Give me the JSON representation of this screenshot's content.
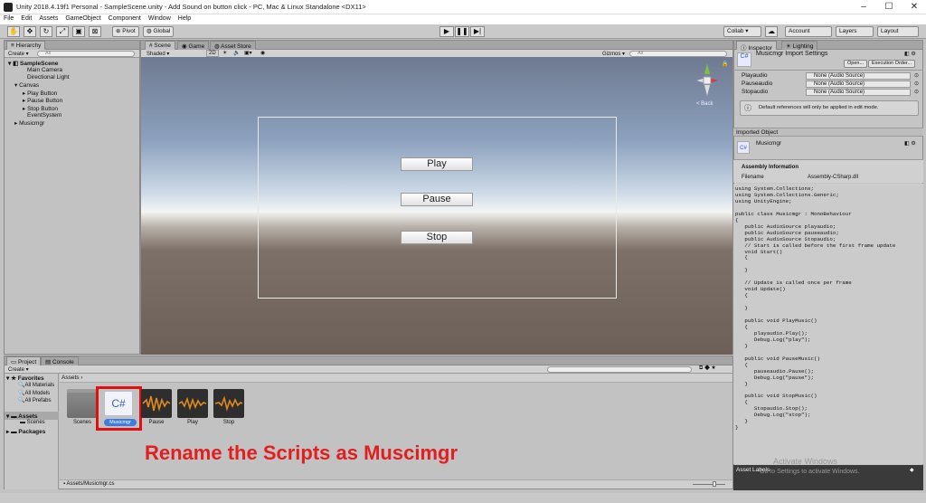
{
  "window": {
    "title": "Unity 2018.4.19f1 Personal - SampleScene.unity - Add Sound on button click - PC, Mac & Linux Standalone <DX11>"
  },
  "menu": [
    "File",
    "Edit",
    "Assets",
    "GameObject",
    "Component",
    "Window",
    "Help"
  ],
  "toolbar": {
    "pivot": "Pivot",
    "global": "Global",
    "collab": "Collab ▾",
    "account": "Account",
    "layers": "Layers",
    "layout": "Layout"
  },
  "hierarchy": {
    "tab": "Hierarchy",
    "create": "Create",
    "search": "All",
    "scene": "SampleScene",
    "items": [
      "Main Camera",
      "Directional Light",
      "Canvas",
      "Play Button",
      "Pause Button",
      "Stop Button",
      "EventSystem",
      "Musicmgr"
    ]
  },
  "scene_view": {
    "tabs": [
      "Scene",
      "Game",
      "Asset Store"
    ],
    "shading": "Shaded",
    "mode2d": "2D",
    "gizmos": "Gizmos",
    "search": "All",
    "back": "< Back",
    "buttons": {
      "play": "Play",
      "pause": "Pause",
      "stop": "Stop"
    }
  },
  "inspector": {
    "tabs": [
      "Inspector",
      "Lighting"
    ],
    "title": "Musicmgr Import Settings",
    "open": "Open...",
    "exec_order": "Execution Order...",
    "fields": [
      {
        "label": "Playaudio",
        "value": "None (Audio Source)"
      },
      {
        "label": "Pauseaudio",
        "value": "None (Audio Source)"
      },
      {
        "label": "Stopaudio",
        "value": "None (Audio Source)"
      }
    ],
    "info": "Default references will only be applied in edit mode.",
    "imported_object": "Imported Object",
    "object_name": "Musicmgr",
    "assembly_info": "Assembly Information",
    "filename_label": "Filename",
    "filename_value": "Assembly-CSharp.dll",
    "code": "using System.Collections;\nusing System.Collections.Generic;\nusing UnityEngine;\n\npublic class Musicmgr : MonoBehaviour\n{\n   public AudioSource playaudio;\n   public AudioSource pauseaudio;\n   public AudioSource Stopaudio;\n   // Start is called before the first frame update\n   void Start()\n   {\n\n   }\n\n   // Update is called once per frame\n   void Update()\n   {\n\n   }\n\n   public void PlayMusic()\n   {\n      playaudio.Play();\n      Debug.Log(\"play\");\n   }\n\n   public void PauseMusic()\n   {\n      pauseaudio.Pause();\n      Debug.Log(\"pause\");\n   }\n\n   public void StopMusic()\n   {\n      Stopaudio.Stop();\n      Debug.Log(\"stop\");\n   }\n}",
    "asset_labels": "Asset Labels",
    "watermark1": "Activate Windows",
    "watermark2": "Go to Settings to activate Windows."
  },
  "project": {
    "tabs": [
      "Project",
      "Console"
    ],
    "create": "Create",
    "favorites": "Favorites",
    "fav_items": [
      "All Materials",
      "All Models",
      "All Prefabs"
    ],
    "assets_root": "Assets",
    "asset_children": [
      "Scenes"
    ],
    "packages": "Packages",
    "breadcrumb": "Assets  ›",
    "assets": [
      {
        "name": "Scenes"
      },
      {
        "name": "Musicmgr"
      },
      {
        "name": "Pause"
      },
      {
        "name": "Play"
      },
      {
        "name": "Stop"
      }
    ],
    "script_glyph": "C#",
    "status_path": "Assets/Musicmgr.cs"
  },
  "overlay_caption": "Rename the Scripts as Muscimgr",
  "colors": {
    "caption": "#e31e1e",
    "selection": "#3e7de0",
    "audio": "#e08a1e"
  }
}
